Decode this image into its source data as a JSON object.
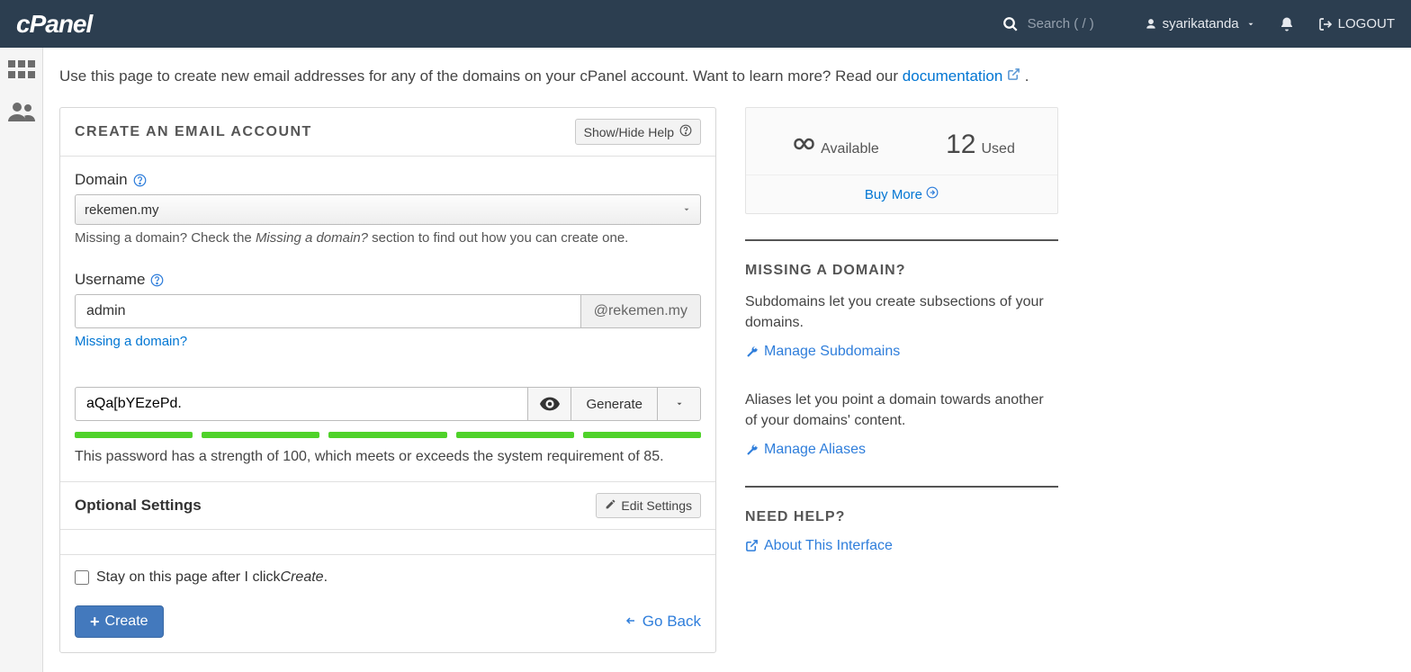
{
  "topbar": {
    "logo": "cPanel",
    "search_placeholder": "Search ( / )",
    "user": "syarikatanda",
    "logout": "LOGOUT"
  },
  "intro": {
    "text_before": "Use this page to create new email addresses for any of the domains on your cPanel account. Want to learn more? Read our ",
    "doc_link": "documentation",
    "text_after": "."
  },
  "panel": {
    "title": "CREATE AN EMAIL ACCOUNT",
    "help_button": "Show/Hide Help"
  },
  "domain": {
    "label": "Domain",
    "selected": "rekemen.my",
    "help_before": "Missing a domain? Check the ",
    "help_em": "Missing a domain?",
    "help_after": " section to find out how you can create one."
  },
  "username": {
    "label": "Username",
    "value": "admin",
    "suffix": "@rekemen.my",
    "missing_link": "Missing a domain?"
  },
  "password": {
    "value": "aQa[bYEzePd.",
    "generate": "Generate",
    "strength_text": "This password has a strength of 100, which meets or exceeds the system requirement of 85."
  },
  "optional": {
    "title": "Optional Settings",
    "edit": "Edit Settings"
  },
  "footer": {
    "stay_before": "Stay on this page after I click ",
    "stay_em": "Create",
    "stay_after": ".",
    "create": "Create",
    "go_back": "Go Back"
  },
  "stats": {
    "available_label": "Available",
    "available_value": "∞",
    "used_label": "Used",
    "used_value": "12",
    "buy_more": "Buy More"
  },
  "missing": {
    "title": "MISSING A DOMAIN?",
    "text1": "Subdomains let you create subsections of your domains.",
    "link1": "Manage Subdomains",
    "text2": "Aliases let you point a domain towards another of your domains' content.",
    "link2": "Manage Aliases"
  },
  "help": {
    "title": "NEED HELP?",
    "link": "About This Interface"
  }
}
